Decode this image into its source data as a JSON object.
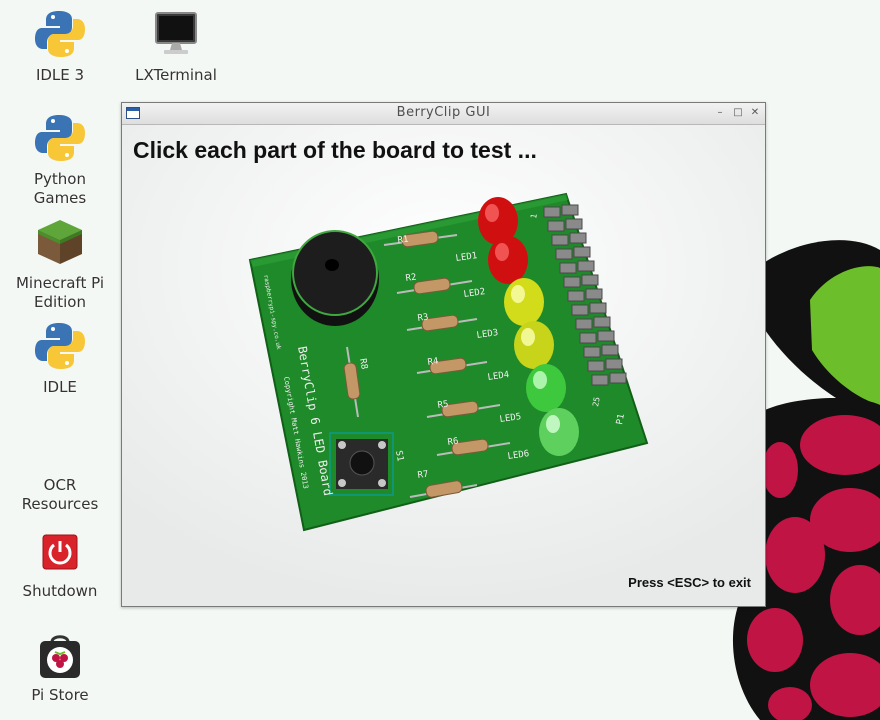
{
  "desktop": {
    "icons": [
      {
        "label": "IDLE 3",
        "icon": "python-icon"
      },
      {
        "label": "LXTerminal",
        "icon": "terminal-icon"
      },
      {
        "label": "Python Games",
        "icon": "python-icon"
      },
      {
        "label": "Minecraft Pi Edition",
        "icon": "minecraft-icon"
      },
      {
        "label": "IDLE",
        "icon": "python-icon"
      },
      {
        "label": "OCR Resources",
        "icon": "none"
      },
      {
        "label": "Shutdown",
        "icon": "shutdown-icon"
      },
      {
        "label": "Pi Store",
        "icon": "pi-store-icon"
      }
    ]
  },
  "window": {
    "title": "BerryClip GUI",
    "heading": "Click each part of the board to test ...",
    "hint": "Press <ESC> to exit",
    "buttons": {
      "minimize": "–",
      "maximize": "□",
      "close": "✕"
    }
  },
  "board": {
    "silkscreen": {
      "name": "BerryClip 6 LED Board",
      "copyright": "Copyright Matt Hawkins 2013",
      "site": "raspberrypi-spy.co.uk",
      "resistors": [
        "R1",
        "R2",
        "R3",
        "R4",
        "R5",
        "R6",
        "R7",
        "R8"
      ],
      "leds": [
        "LED1",
        "LED2",
        "LED3",
        "LED4",
        "LED5",
        "LED6"
      ],
      "switch": "S1",
      "pin1": "1",
      "pin25": "25",
      "p1": "P1"
    },
    "led_colors": [
      "#e01818",
      "#e01818",
      "#d6e020",
      "#d6e020",
      "#3ec83e",
      "#3ec83e"
    ],
    "pcb_color": "#1f8a2a"
  },
  "colors": {
    "raspberry": "#c01445",
    "leaf": "#6cbf2a"
  }
}
